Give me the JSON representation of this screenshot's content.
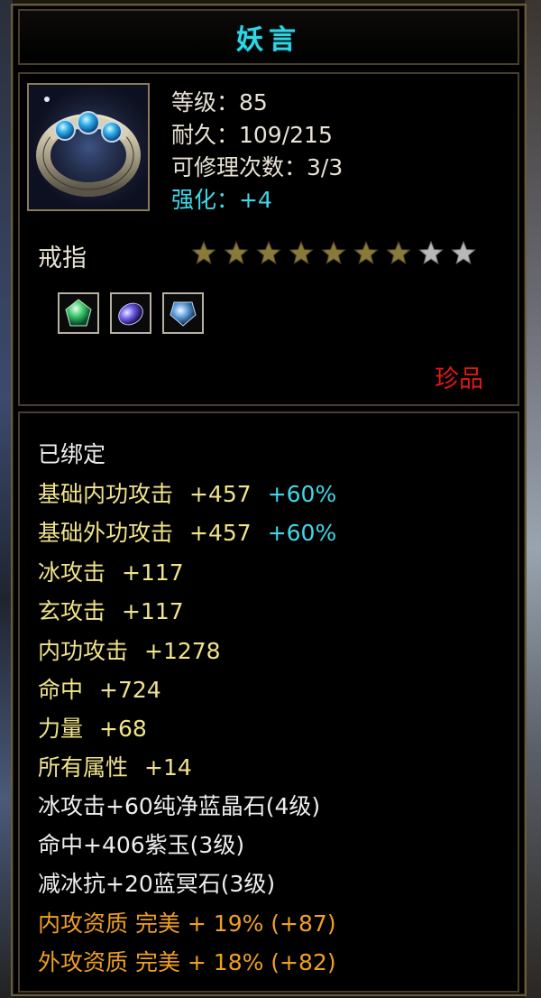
{
  "item": {
    "name": "妖言",
    "level_line": "等级：85",
    "durability_line": "耐久：109/215",
    "repair_line": "可修理次数：3/3",
    "enhance_line": "强化：+4",
    "type": "戒指",
    "rarity": "珍品",
    "stars_filled": 7,
    "stars_total": 9,
    "gems": [
      "green-gem-icon",
      "purple-gem-icon",
      "blue-gem-icon"
    ]
  },
  "attributes": {
    "bound": "已绑定",
    "base_inner_label": "基础内功攻击",
    "base_inner_value": "+457",
    "base_inner_bonus": "+60%",
    "base_outer_label": "基础外功攻击",
    "base_outer_value": "+457",
    "base_outer_bonus": "+60%",
    "ice_atk_label": "冰攻击",
    "ice_atk_value": "+117",
    "xuan_atk_label": "玄攻击",
    "xuan_atk_value": "+117",
    "inner_atk_label": "内功攻击",
    "inner_atk_value": "+1278",
    "hit_label": "命中",
    "hit_value": "+724",
    "strength_label": "力量",
    "strength_value": "+68",
    "all_attr_label": "所有属性",
    "all_attr_value": "+14",
    "gem1": "冰攻击+60纯净蓝晶石(4级)",
    "gem2": "命中+406紫玉(3级)",
    "gem3": "减冰抗+20蓝冥石(3级)",
    "quality1": "内攻资质 完美 + 19% (+87)",
    "quality2": "外攻资质 完美 + 18% (+82)"
  },
  "colors": {
    "title": "#2fd6e6",
    "rarity": "#e01818",
    "star_filled": "#8a7a3a",
    "star_empty": "#b8b8b8"
  }
}
